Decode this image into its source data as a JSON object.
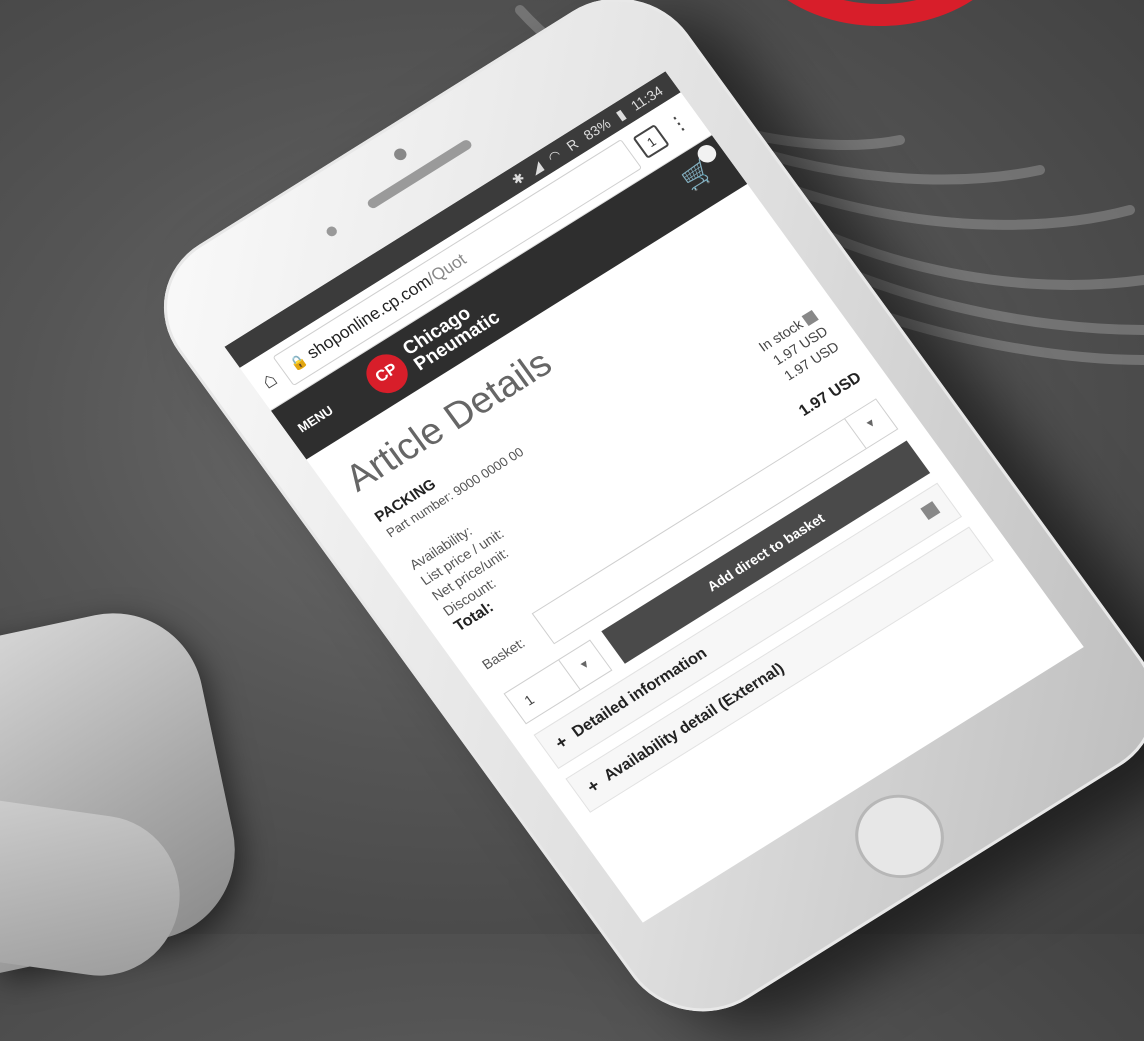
{
  "status_bar": {
    "battery": "83%",
    "time": "11:34",
    "signal_letter": "R"
  },
  "browser": {
    "url_host": "shoponline.cp.com",
    "url_path": "/Quot",
    "tab_count": "1"
  },
  "site": {
    "menu_label": "MENU",
    "logo_line1": "Chicago",
    "logo_line2": "Pneumatic",
    "logo_mark": "CP"
  },
  "article": {
    "page_title": "Article Details",
    "product_name": "PACKING",
    "part_number": "Part number: 9000 0000 00",
    "availability_label": "Availability:",
    "availability_value": "In stock",
    "list_price_label": "List price / unit:",
    "list_price_value": "1.97 USD",
    "net_price_label": "Net price/unit:",
    "net_price_value": "1.97 USD",
    "discount_label": "Discount:",
    "total_label": "Total:",
    "total_value": "1.97 USD",
    "basket_label": "Basket:",
    "quantity": "1",
    "add_button": "Add direct to basket",
    "acc_detailed": "Detailed information",
    "acc_availability": "Availability detail (External)"
  },
  "colors": {
    "brand_red": "#d81e2a",
    "header_dark": "#2e2e2e"
  }
}
